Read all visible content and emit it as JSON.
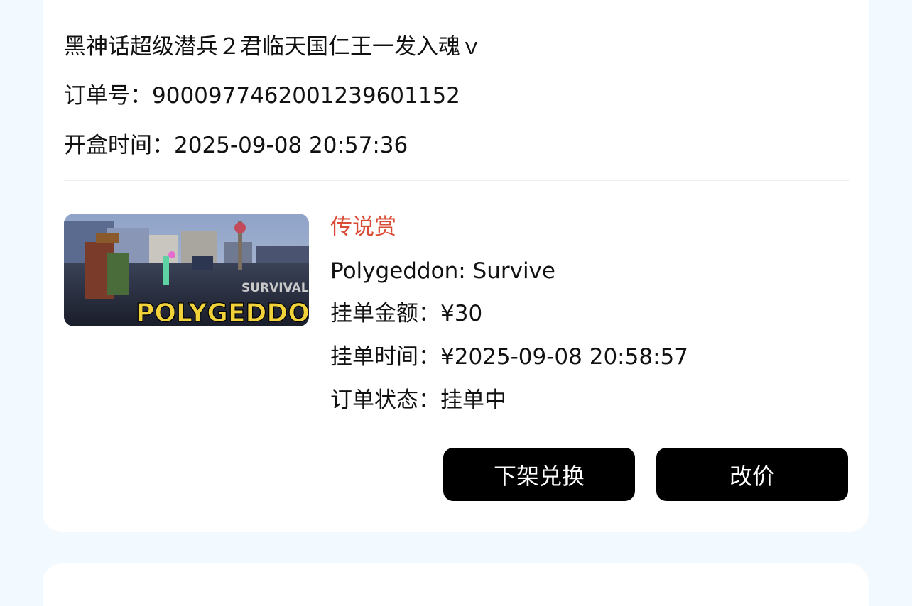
{
  "order": {
    "title": "黑神话超级潜兵２君临天国仁王一发入魂ｖ",
    "order_no_label": "订单号：",
    "order_no": "9000977462001239601152",
    "open_time_label": "开盒时间：",
    "open_time": "2025-09-08 20:57:36"
  },
  "item": {
    "rarity": "传说赏",
    "rarity_color": "#d94b34",
    "name": "Polygeddon: Survive",
    "price_label": "挂单金额：",
    "price": "¥30",
    "list_time_label": "挂单时间：",
    "list_time": "¥2025-09-08 20:58:57",
    "status_label": "订单状态：",
    "status": "挂单中",
    "image": {
      "logo_small": "SURVIVAL",
      "logo_big": "POLYGEDDON"
    }
  },
  "actions": {
    "delist_label": "下架兑换",
    "reprice_label": "改价"
  }
}
